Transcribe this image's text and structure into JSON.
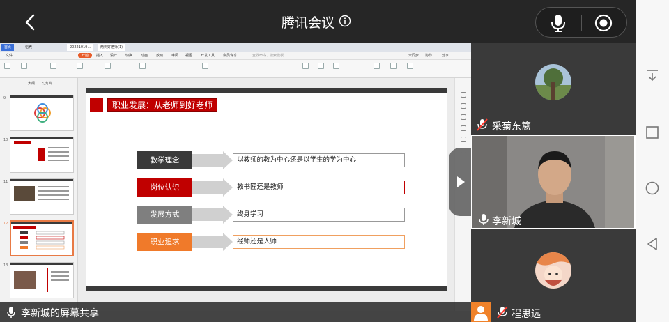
{
  "header": {
    "title": "腾讯会议",
    "back_icon": "chevron-left-icon",
    "info_icon": "info-icon",
    "mic_icon": "microphone-icon",
    "record_icon": "record-icon"
  },
  "wps": {
    "tabs": [
      "首页",
      "稻壳",
      "20221019…",
      "两到好老师(1)"
    ],
    "menu": [
      "文件",
      "开始",
      "插入",
      "设计",
      "切换",
      "动画",
      "放映",
      "审阅",
      "视图",
      "开发工具",
      "会员专享",
      "查找命令、搜索模板",
      "未同步",
      "协作",
      "分享"
    ],
    "active_menu": "开始",
    "panel_tabs": [
      "大纲",
      "幻灯片"
    ],
    "thumb_numbers": [
      "9",
      "10",
      "11",
      "12",
      "13"
    ]
  },
  "slide": {
    "title": "职业发展：从老师到好老师",
    "rows": [
      {
        "label": "教学理念",
        "text": "以教师的教为中心还是以学生的学为中心",
        "color": "#3a3a3a",
        "border": "#999999"
      },
      {
        "label": "岗位认识",
        "text": "教书匠还是教师",
        "color": "#c00000",
        "border": "#c00000"
      },
      {
        "label": "发展方式",
        "text": "终身学习",
        "color": "#7f7f7f",
        "border": "#999999"
      },
      {
        "label": "职业追求",
        "text": "经师还是人师",
        "color": "#f07a2a",
        "border": "#f0a060"
      }
    ]
  },
  "share_banner": {
    "text": "李新城的屏幕共享"
  },
  "participants": [
    {
      "name": "采菊东篱",
      "mic": "microphone-muted-icon"
    },
    {
      "name": "李新城",
      "mic": "microphone-icon"
    },
    {
      "name": "程思远",
      "mic": "microphone-muted-icon"
    }
  ],
  "colors": {
    "accent_red": "#c00000",
    "accent_orange": "#f07a2a",
    "bg_dark": "#262626"
  }
}
